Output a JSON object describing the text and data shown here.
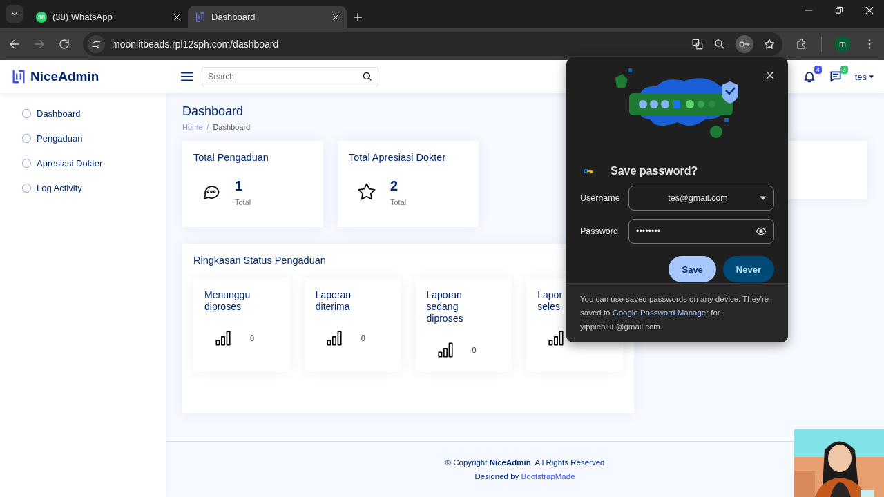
{
  "browser": {
    "tabs": [
      {
        "title": "(38) WhatsApp",
        "badge": "38",
        "selected": false
      },
      {
        "title": "Dashboard",
        "selected": true
      }
    ],
    "url": "moonlitbeads.rpl12sph.com/dashboard",
    "profile": "m"
  },
  "header": {
    "brand": "NiceAdmin",
    "search": {
      "placeholder": "Search"
    },
    "notifications": "4",
    "messages": "3",
    "user": "tes"
  },
  "sidebar": {
    "items": [
      {
        "label": "Dashboard",
        "selected": false
      },
      {
        "label": "Pengaduan",
        "selected": false
      },
      {
        "label": "Apresiasi Dokter",
        "selected": false
      },
      {
        "label": "Log Activity",
        "selected": false
      }
    ]
  },
  "page": {
    "title": "Dashboard",
    "breadcrumbs": [
      "Home",
      "Dashboard"
    ],
    "breadcrumb_separator": "/"
  },
  "stats": [
    {
      "title": "Total Pengaduan",
      "value": "1",
      "caption": "Total"
    },
    {
      "title": "Total Apresiasi Dokter",
      "value": "2",
      "caption": "Total"
    }
  ],
  "summary": {
    "title": "Ringkasan Status Pengaduan",
    "items": [
      {
        "label": "Menunggu diproses",
        "value": "0"
      },
      {
        "label": "Laporan diterima",
        "value": "0"
      },
      {
        "label": "Laporan sedang diproses",
        "value": "0"
      },
      {
        "label": "Lapor seles"
      }
    ]
  },
  "footer": {
    "copyright": "© Copyright **NiceAdmin**. All Rights Reserved",
    "designed_by": "Designed by",
    "designer_link": "BootstrapMade"
  },
  "password_dialog": {
    "title": "Save password?",
    "username_label": "Username",
    "username": "tes@gmail.com",
    "password_label": "Password",
    "password": "••••••••",
    "buttons": [
      "Save",
      "Never"
    ],
    "note_before": "You can use saved passwords on any device. They're saved to",
    "note_link": "Google Password Manager",
    "note_after": "for yippiebluu@gmail.com."
  }
}
